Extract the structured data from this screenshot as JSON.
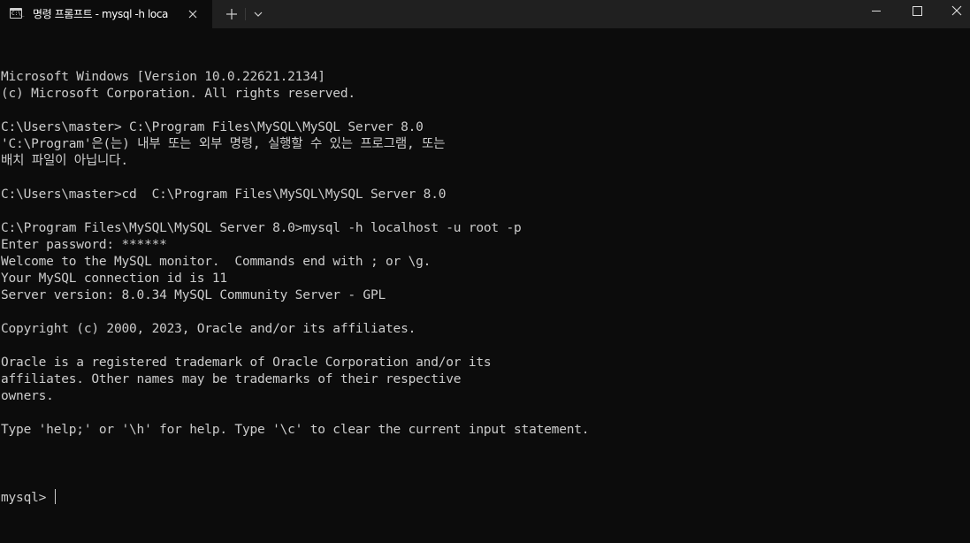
{
  "window": {
    "tab_title": "명령 프롬프트 - mysql  -h loca",
    "tab_icon_text": "C:\\_",
    "colors": {
      "background": "#0c0c0c",
      "titlebar": "#202020",
      "text": "#cccccc"
    }
  },
  "console": {
    "lines": [
      "Microsoft Windows [Version 10.0.22621.2134]",
      "(c) Microsoft Corporation. All rights reserved.",
      "",
      "C:\\Users\\master> C:\\Program Files\\MySQL\\MySQL Server 8.0",
      "'C:\\Program'은(는) 내부 또는 외부 명령, 실행할 수 있는 프로그램, 또는",
      "배치 파일이 아닙니다.",
      "",
      "C:\\Users\\master>cd  C:\\Program Files\\MySQL\\MySQL Server 8.0",
      "",
      "C:\\Program Files\\MySQL\\MySQL Server 8.0>mysql -h localhost -u root -p",
      "Enter password: ******",
      "Welcome to the MySQL monitor.  Commands end with ; or \\g.",
      "Your MySQL connection id is 11",
      "Server version: 8.0.34 MySQL Community Server - GPL",
      "",
      "Copyright (c) 2000, 2023, Oracle and/or its affiliates.",
      "",
      "Oracle is a registered trademark of Oracle Corporation and/or its",
      "affiliates. Other names may be trademarks of their respective",
      "owners.",
      "",
      "Type 'help;' or '\\h' for help. Type '\\c' to clear the current input statement.",
      ""
    ],
    "prompt": "mysql> "
  },
  "icons": {
    "tab": "command-prompt-icon",
    "close_tab": "close-icon",
    "new_tab": "plus-icon",
    "dropdown": "chevron-down-icon",
    "minimize": "minimize-icon",
    "maximize": "maximize-icon",
    "close_window": "close-icon"
  }
}
